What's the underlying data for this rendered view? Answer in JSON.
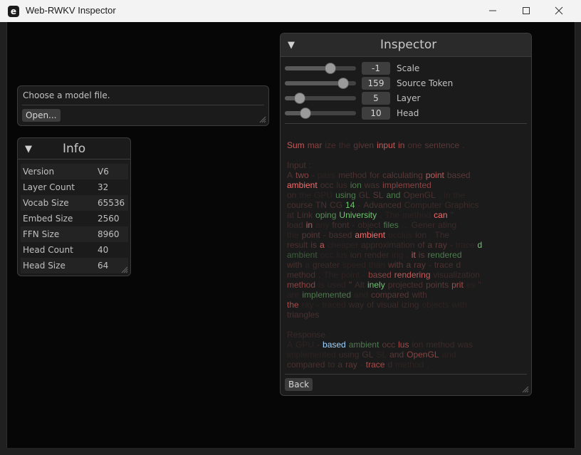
{
  "window": {
    "title": "Web-RWKV Inspector",
    "icon": "app-logo-icon"
  },
  "file_panel": {
    "prompt": "Choose a model file.",
    "open_button": "Open..."
  },
  "info": {
    "title": "Info",
    "rows": [
      {
        "key": "Version",
        "value": "V6"
      },
      {
        "key": "Layer Count",
        "value": "32"
      },
      {
        "key": "Vocab Size",
        "value": "65536"
      },
      {
        "key": "Embed Size",
        "value": "2560"
      },
      {
        "key": "FFN Size",
        "value": "8960"
      },
      {
        "key": "Head Count",
        "value": "40"
      },
      {
        "key": "Head Size",
        "value": "64"
      }
    ]
  },
  "inspector": {
    "title": "Inspector",
    "sliders": [
      {
        "label": "Scale",
        "value": "-1",
        "level": 0.64
      },
      {
        "label": "Source Token",
        "value": "159",
        "level": 0.82
      },
      {
        "label": "Layer",
        "value": "5",
        "level": 0.21
      },
      {
        "label": "Head",
        "value": "10",
        "level": 0.29
      }
    ],
    "back_button": "Back",
    "colors": {
      "hot": "#f06d6d",
      "mid_red": "#a84b4b",
      "dim_red": "#5a3535",
      "green": "#72c272",
      "dim_green": "#3d5c3d",
      "cyan": "#9fd4ff"
    },
    "token_lines": [
      [
        {
          "t": "Sum",
          "c": "#c25c5c"
        },
        {
          "t": "mar",
          "c": "#8a4444"
        },
        {
          "t": "ize",
          "c": "#4a2c2c"
        },
        {
          "t": "the",
          "c": "#3c2a2a"
        },
        {
          "t": "given",
          "c": "#5a3838"
        },
        {
          "t": "input",
          "c": "#c25c5c"
        },
        {
          "t": "in",
          "c": "#a84b4b"
        },
        {
          "t": "one",
          "c": "#4a3030"
        },
        {
          "t": "sentence",
          "c": "#5a3838"
        },
        {
          "t": ".",
          "c": "#3c2a2a"
        }
      ],
      [],
      [
        {
          "t": "Input",
          "c": "#4a3030"
        },
        {
          "t": ":",
          "c": "#3c2a2a"
        }
      ],
      [
        {
          "t": "A",
          "c": "#4a3030"
        },
        {
          "t": "two",
          "c": "#8a4444"
        },
        {
          "t": "-",
          "c": "#3c2a2a"
        },
        {
          "t": "pass",
          "c": "#2e2222"
        },
        {
          "t": "method",
          "c": "#4a3030"
        },
        {
          "t": "for",
          "c": "#4a3030"
        },
        {
          "t": "calculating",
          "c": "#5a3838"
        },
        {
          "t": "point",
          "c": "#c25c5c"
        },
        {
          "t": "based",
          "c": "#5a3838"
        }
      ],
      [
        {
          "t": "ambient",
          "c": "#f06d6d"
        },
        {
          "t": "occ",
          "c": "#4a3030"
        },
        {
          "t": "lus",
          "c": "#3c2a2a"
        },
        {
          "t": "ion",
          "c": "#4e7a4e"
        },
        {
          "t": "was",
          "c": "#4a3030"
        },
        {
          "t": "implemented",
          "c": "#8a4444"
        }
      ],
      [
        {
          "t": "on",
          "c": "#3c2a2a"
        },
        {
          "t": "the",
          "c": "#2e2222"
        },
        {
          "t": "GPU",
          "c": "#2e2222"
        },
        {
          "t": "using",
          "c": "#4e7a4e"
        },
        {
          "t": "GL",
          "c": "#4a3030"
        },
        {
          "t": "SL",
          "c": "#5a3838"
        },
        {
          "t": "and",
          "c": "#4e7a4e"
        },
        {
          "t": "OpenGL",
          "c": "#4a3030"
        },
        {
          "t": ",",
          "c": "#2e2222"
        },
        {
          "t": "in",
          "c": "#2e2222"
        },
        {
          "t": "the",
          "c": "#2e2222"
        }
      ],
      [
        {
          "t": "course",
          "c": "#4a3030"
        },
        {
          "t": "TN",
          "c": "#4a3030"
        },
        {
          "t": "CG",
          "c": "#4a3030"
        },
        {
          "t": "14",
          "c": "#72c272"
        },
        {
          "t": "-",
          "c": "#3c2a2a"
        },
        {
          "t": "Advanced",
          "c": "#4a3030"
        },
        {
          "t": "Computer",
          "c": "#3c2a2a"
        },
        {
          "t": "Graphics",
          "c": "#3c2a2a"
        }
      ],
      [
        {
          "t": "at",
          "c": "#3c2a2a"
        },
        {
          "t": "Link",
          "c": "#4a3030"
        },
        {
          "t": "oping",
          "c": "#5a8a5a"
        },
        {
          "t": "University",
          "c": "#72c272"
        },
        {
          "t": ".",
          "c": "#3c2a2a"
        },
        {
          "t": "The",
          "c": "#2e2222"
        },
        {
          "t": "method",
          "c": "#2e2222"
        },
        {
          "t": "can",
          "c": "#f06d6d"
        },
        {
          "t": "\"",
          "c": "#3c2a2a"
        }
      ],
      [
        {
          "t": "load",
          "c": "#3c2a2a"
        },
        {
          "t": "in",
          "c": "#c25c5c"
        },
        {
          "t": "any",
          "c": "#2e2222"
        },
        {
          "t": "front",
          "c": "#4a3030"
        },
        {
          "t": "-",
          "c": "#3c2a2a"
        },
        {
          "t": "object",
          "c": "#3c2a2a"
        },
        {
          "t": "files",
          "c": "#4e7a4e"
        },
        {
          "t": "...",
          "c": "#2e2222"
        },
        {
          "t": "Gener",
          "c": "#3c2a2a"
        },
        {
          "t": "ating",
          "c": "#3c2a2a"
        }
      ],
      [
        {
          "t": "the",
          "c": "#2e2222"
        },
        {
          "t": "point",
          "c": "#5a3838"
        },
        {
          "t": "-",
          "c": "#3c2a2a"
        },
        {
          "t": "based",
          "c": "#4a3030"
        },
        {
          "t": "ambient",
          "c": "#f06d6d"
        },
        {
          "t": "occlus",
          "c": "#2e2222"
        },
        {
          "t": "ion",
          "c": "#3c2a2a"
        },
        {
          "t": ".",
          "c": "#2e2222"
        },
        {
          "t": "The",
          "c": "#3c2a2a"
        }
      ],
      [
        {
          "t": "result",
          "c": "#4a3030"
        },
        {
          "t": "is",
          "c": "#5a3838"
        },
        {
          "t": "a",
          "c": "#c25c5c"
        },
        {
          "t": "cheaper",
          "c": "#2e2222"
        },
        {
          "t": "approximation",
          "c": "#3c2a2a"
        },
        {
          "t": "of",
          "c": "#4a3030"
        },
        {
          "t": "a",
          "c": "#5a3838"
        },
        {
          "t": "ray",
          "c": "#5a3838"
        },
        {
          "t": "-",
          "c": "#3c2a2a"
        },
        {
          "t": "trace",
          "c": "#2e2222"
        },
        {
          "t": "d",
          "c": "#72c272"
        }
      ],
      [
        {
          "t": "ambient",
          "c": "#3d5c3d"
        },
        {
          "t": "occ",
          "c": "#2e2222"
        },
        {
          "t": "lus",
          "c": "#2e2222"
        },
        {
          "t": "ion",
          "c": "#3c2a2a"
        },
        {
          "t": "render",
          "c": "#3c2a2a"
        },
        {
          "t": "ing",
          "c": "#2e2222"
        },
        {
          "t": ",",
          "c": "#2e2222"
        },
        {
          "t": "it",
          "c": "#c25c5c"
        },
        {
          "t": "is",
          "c": "#5a3838"
        },
        {
          "t": "rendered",
          "c": "#4e7a4e"
        }
      ],
      [
        {
          "t": "with",
          "c": "#4a3030"
        },
        {
          "t": "a",
          "c": "#2e2222"
        },
        {
          "t": "greater",
          "c": "#3c2a2a"
        },
        {
          "t": "speed",
          "c": "#2e2222"
        },
        {
          "t": "than",
          "c": "#2e2222"
        },
        {
          "t": "with",
          "c": "#5a3838"
        },
        {
          "t": "a",
          "c": "#5a3838"
        },
        {
          "t": "ray",
          "c": "#5a3838"
        },
        {
          "t": "-",
          "c": "#3c2a2a"
        },
        {
          "t": "trace",
          "c": "#4a3030"
        },
        {
          "t": "d",
          "c": "#4a3030"
        }
      ],
      [
        {
          "t": "method",
          "c": "#4a3030"
        },
        {
          "t": ".",
          "c": "#3c2a2a"
        },
        {
          "t": "The",
          "c": "#2e2222"
        },
        {
          "t": "point",
          "c": "#2e2222"
        },
        {
          "t": "-",
          "c": "#2e2222"
        },
        {
          "t": "based",
          "c": "#8a4444"
        },
        {
          "t": "rendering",
          "c": "#c25c5c"
        },
        {
          "t": "visualization",
          "c": "#3c2a2a"
        }
      ],
      [
        {
          "t": "method",
          "c": "#8a4444"
        },
        {
          "t": "is",
          "c": "#2e2222"
        },
        {
          "t": "used",
          "c": "#2e2222"
        },
        {
          "t": "\"",
          "c": "#5a3838"
        },
        {
          "t": "Alt",
          "c": "#3c2a2a"
        },
        {
          "t": "inely",
          "c": "#72c272"
        },
        {
          "t": "projected",
          "c": "#4a3030"
        },
        {
          "t": "points",
          "c": "#5a3838"
        },
        {
          "t": "prit",
          "c": "#a84b4b"
        },
        {
          "t": "es",
          "c": "#2e2222"
        },
        {
          "t": "\"",
          "c": "#3c2a2a"
        }
      ],
      [
        {
          "t": "are",
          "c": "#2e2222"
        },
        {
          "t": "implemented",
          "c": "#4e7a4e"
        },
        {
          "t": "and",
          "c": "#2e2222"
        },
        {
          "t": "compared",
          "c": "#5a3838"
        },
        {
          "t": "with",
          "c": "#4a3030"
        }
      ],
      [
        {
          "t": "the",
          "c": "#a84b4b"
        },
        {
          "t": "ray",
          "c": "#2e2222"
        },
        {
          "t": "-",
          "c": "#2e2222"
        },
        {
          "t": "traced",
          "c": "#2e2222"
        },
        {
          "t": "way",
          "c": "#3c2a2a"
        },
        {
          "t": "of",
          "c": "#3c2a2a"
        },
        {
          "t": "visual",
          "c": "#3c2a2a"
        },
        {
          "t": "izing",
          "c": "#3c2a2a"
        },
        {
          "t": "objects",
          "c": "#2e2222"
        },
        {
          "t": "with",
          "c": "#2e2222"
        }
      ],
      [
        {
          "t": "triangles",
          "c": "#4a3030"
        },
        {
          "t": ".",
          "c": "#2e2222"
        }
      ],
      [],
      [
        {
          "t": "Response",
          "c": "#3c2a2a"
        },
        {
          "t": ":",
          "c": "#2e2222"
        }
      ],
      [
        {
          "t": "A",
          "c": "#2e2222"
        },
        {
          "t": "GPU",
          "c": "#2e2222"
        },
        {
          "t": "-",
          "c": "#3c2a2a"
        },
        {
          "t": "based",
          "c": "#9fd4ff"
        },
        {
          "t": "ambient",
          "c": "#4e7a4e"
        },
        {
          "t": "occ",
          "c": "#5a3838"
        },
        {
          "t": "lus",
          "c": "#a84b4b"
        },
        {
          "t": "ion",
          "c": "#3c2a2a"
        },
        {
          "t": "method",
          "c": "#3c2a2a"
        },
        {
          "t": "was",
          "c": "#3c2a2a"
        }
      ],
      [
        {
          "t": "implemented",
          "c": "#2e2222"
        },
        {
          "t": "using",
          "c": "#3c2a2a"
        },
        {
          "t": "GL",
          "c": "#4a3030"
        },
        {
          "t": "SL",
          "c": "#2e2222"
        },
        {
          "t": "and",
          "c": "#5a3838"
        },
        {
          "t": "OpenGL",
          "c": "#8a4444"
        },
        {
          "t": "and",
          "c": "#2e2222"
        }
      ],
      [
        {
          "t": "compared",
          "c": "#4a3030"
        },
        {
          "t": "to",
          "c": "#3c2a2a"
        },
        {
          "t": "a",
          "c": "#4a3030"
        },
        {
          "t": "ray",
          "c": "#5a3838"
        },
        {
          "t": "-",
          "c": "#2e2222"
        },
        {
          "t": "trace",
          "c": "#a84b4b"
        },
        {
          "t": "d",
          "c": "#3c2a2a"
        },
        {
          "t": "method",
          "c": "#2e2222"
        },
        {
          "t": ".",
          "c": "#2e2222"
        }
      ]
    ]
  }
}
